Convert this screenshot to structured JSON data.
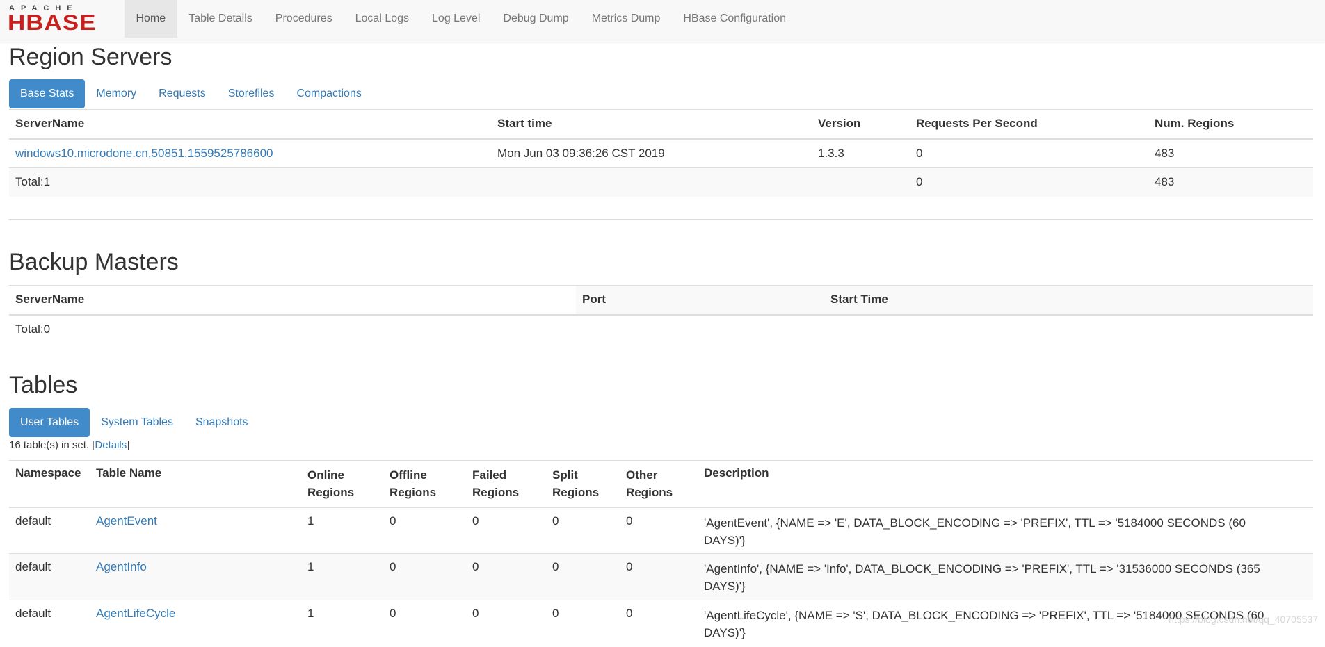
{
  "brand": {
    "apache": "APACHE",
    "hbase": "HBASE"
  },
  "nav": [
    {
      "label": "Home",
      "active": true
    },
    {
      "label": "Table Details"
    },
    {
      "label": "Procedures"
    },
    {
      "label": "Local Logs"
    },
    {
      "label": "Log Level"
    },
    {
      "label": "Debug Dump"
    },
    {
      "label": "Metrics Dump"
    },
    {
      "label": "HBase Configuration"
    }
  ],
  "region_servers": {
    "title": "Region Servers",
    "tabs": [
      "Base Stats",
      "Memory",
      "Requests",
      "Storefiles",
      "Compactions"
    ],
    "headers": [
      "ServerName",
      "Start time",
      "Version",
      "Requests Per Second",
      "Num. Regions"
    ],
    "row": {
      "server": "windows10.microdone.cn,50851,1559525786600",
      "start": "Mon Jun 03 09:36:26 CST 2019",
      "version": "1.3.3",
      "rps": "0",
      "regions": "483"
    },
    "total": {
      "label": "Total:1",
      "rps": "0",
      "regions": "483"
    }
  },
  "backup_masters": {
    "title": "Backup Masters",
    "headers": [
      "ServerName",
      "Port",
      "Start Time"
    ],
    "total": "Total:0"
  },
  "tables": {
    "title": "Tables",
    "tabs": [
      "User Tables",
      "System Tables",
      "Snapshots"
    ],
    "count_prefix": "16 table(s) in set. [",
    "details_link": "Details",
    "count_suffix": "]",
    "headers": {
      "namespace": "Namespace",
      "name": "Table Name",
      "online_1": "Online",
      "online_2": "Regions",
      "offline_1": "Offline",
      "offline_2": "Regions",
      "failed_1": "Failed",
      "failed_2": "Regions",
      "split_1": "Split",
      "split_2": "Regions",
      "other_1": "Other",
      "other_2": "Regions",
      "description": "Description"
    },
    "rows": [
      {
        "ns": "default",
        "name": "AgentEvent",
        "online": "1",
        "offline": "0",
        "failed": "0",
        "split": "0",
        "other": "0",
        "desc1": "'AgentEvent', {NAME => 'E', DATA_BLOCK_ENCODING => 'PREFIX', TTL => '5184000 SECONDS (60",
        "desc2": "DAYS)'}"
      },
      {
        "ns": "default",
        "name": "AgentInfo",
        "online": "1",
        "offline": "0",
        "failed": "0",
        "split": "0",
        "other": "0",
        "desc1": "'AgentInfo', {NAME => 'Info', DATA_BLOCK_ENCODING => 'PREFIX', TTL => '31536000 SECONDS (365",
        "desc2": "DAYS)'}"
      },
      {
        "ns": "default",
        "name": "AgentLifeCycle",
        "online": "1",
        "offline": "0",
        "failed": "0",
        "split": "0",
        "other": "0",
        "desc1": "'AgentLifeCycle', {NAME => 'S', DATA_BLOCK_ENCODING => 'PREFIX', TTL => '5184000 SECONDS (60",
        "desc2": "DAYS)'}"
      }
    ]
  },
  "watermark": "https://blog.csdn.net/qq_40705537"
}
